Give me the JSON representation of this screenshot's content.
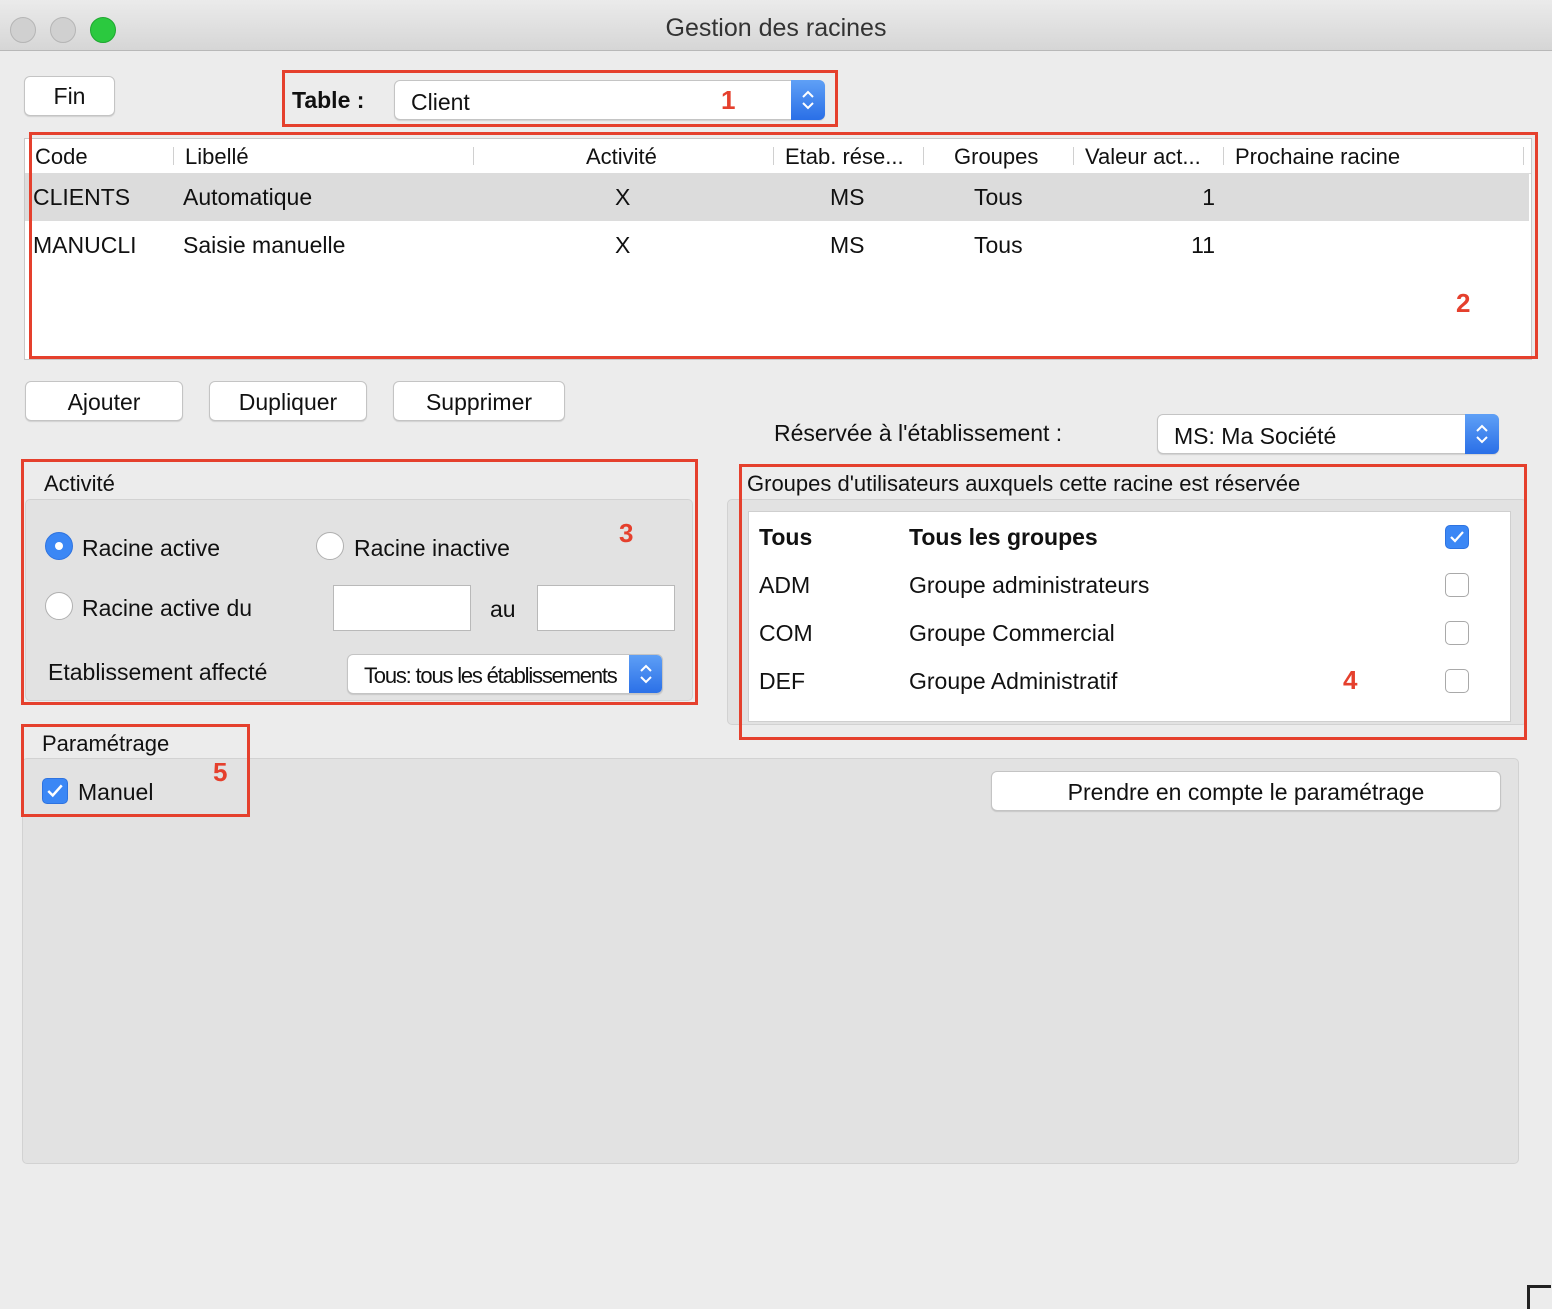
{
  "window": {
    "title": "Gestion des racines",
    "traffic_lights": {
      "close": "#fd5f57",
      "minimize": "#fdbd2f",
      "zoom": "#2bc93f"
    }
  },
  "toolbar": {
    "fin_label": "Fin",
    "table_label": "Table :",
    "table_value": "Client"
  },
  "racines_table": {
    "columns": [
      "Code",
      "Libellé",
      "Activité",
      "Etab. rése...",
      "Groupes",
      "Valeur act...",
      "Prochaine racine"
    ],
    "rows": [
      {
        "code": "CLIENTS",
        "libelle": "Automatique",
        "activite": "X",
        "etab": "MS",
        "groupes": "Tous",
        "valeur": "1",
        "prochaine": ""
      },
      {
        "code": "MANUCLI",
        "libelle": "Saisie manuelle",
        "activite": "X",
        "etab": "MS",
        "groupes": "Tous",
        "valeur": "11",
        "prochaine": ""
      }
    ],
    "selected_row": 0
  },
  "actions": {
    "ajouter": "Ajouter",
    "dupliquer": "Dupliquer",
    "supprimer": "Supprimer"
  },
  "reservee": {
    "label": "Réservée à l'établissement :",
    "value": "MS: Ma Société"
  },
  "activite": {
    "title": "Activité",
    "racine_active": "Racine active",
    "racine_inactive": "Racine inactive",
    "racine_active_du": "Racine active du",
    "au": "au",
    "date_from": "",
    "date_to": "",
    "selected": "racine_active",
    "etablissement_label": "Etablissement affecté",
    "etablissement_value": "Tous: tous les établissements"
  },
  "groupes": {
    "title": "Groupes d'utilisateurs auxquels cette racine est réservée",
    "items": [
      {
        "code": "Tous",
        "name": "Tous les groupes",
        "checked": true
      },
      {
        "code": "ADM",
        "name": "Groupe administrateurs",
        "checked": false
      },
      {
        "code": "COM",
        "name": "Groupe Commercial",
        "checked": false
      },
      {
        "code": "DEF",
        "name": "Groupe Administratif",
        "checked": false
      }
    ]
  },
  "parametrage": {
    "title": "Paramétrage",
    "manuel_label": "Manuel",
    "manuel_checked": true,
    "apply_button": "Prendre en compte le paramétrage"
  },
  "annotations": [
    "1",
    "2",
    "3",
    "4",
    "5"
  ],
  "colors": {
    "accent": "#3b87f5",
    "annotation": "#e5402d",
    "selected_row": "#dcdcdc"
  }
}
